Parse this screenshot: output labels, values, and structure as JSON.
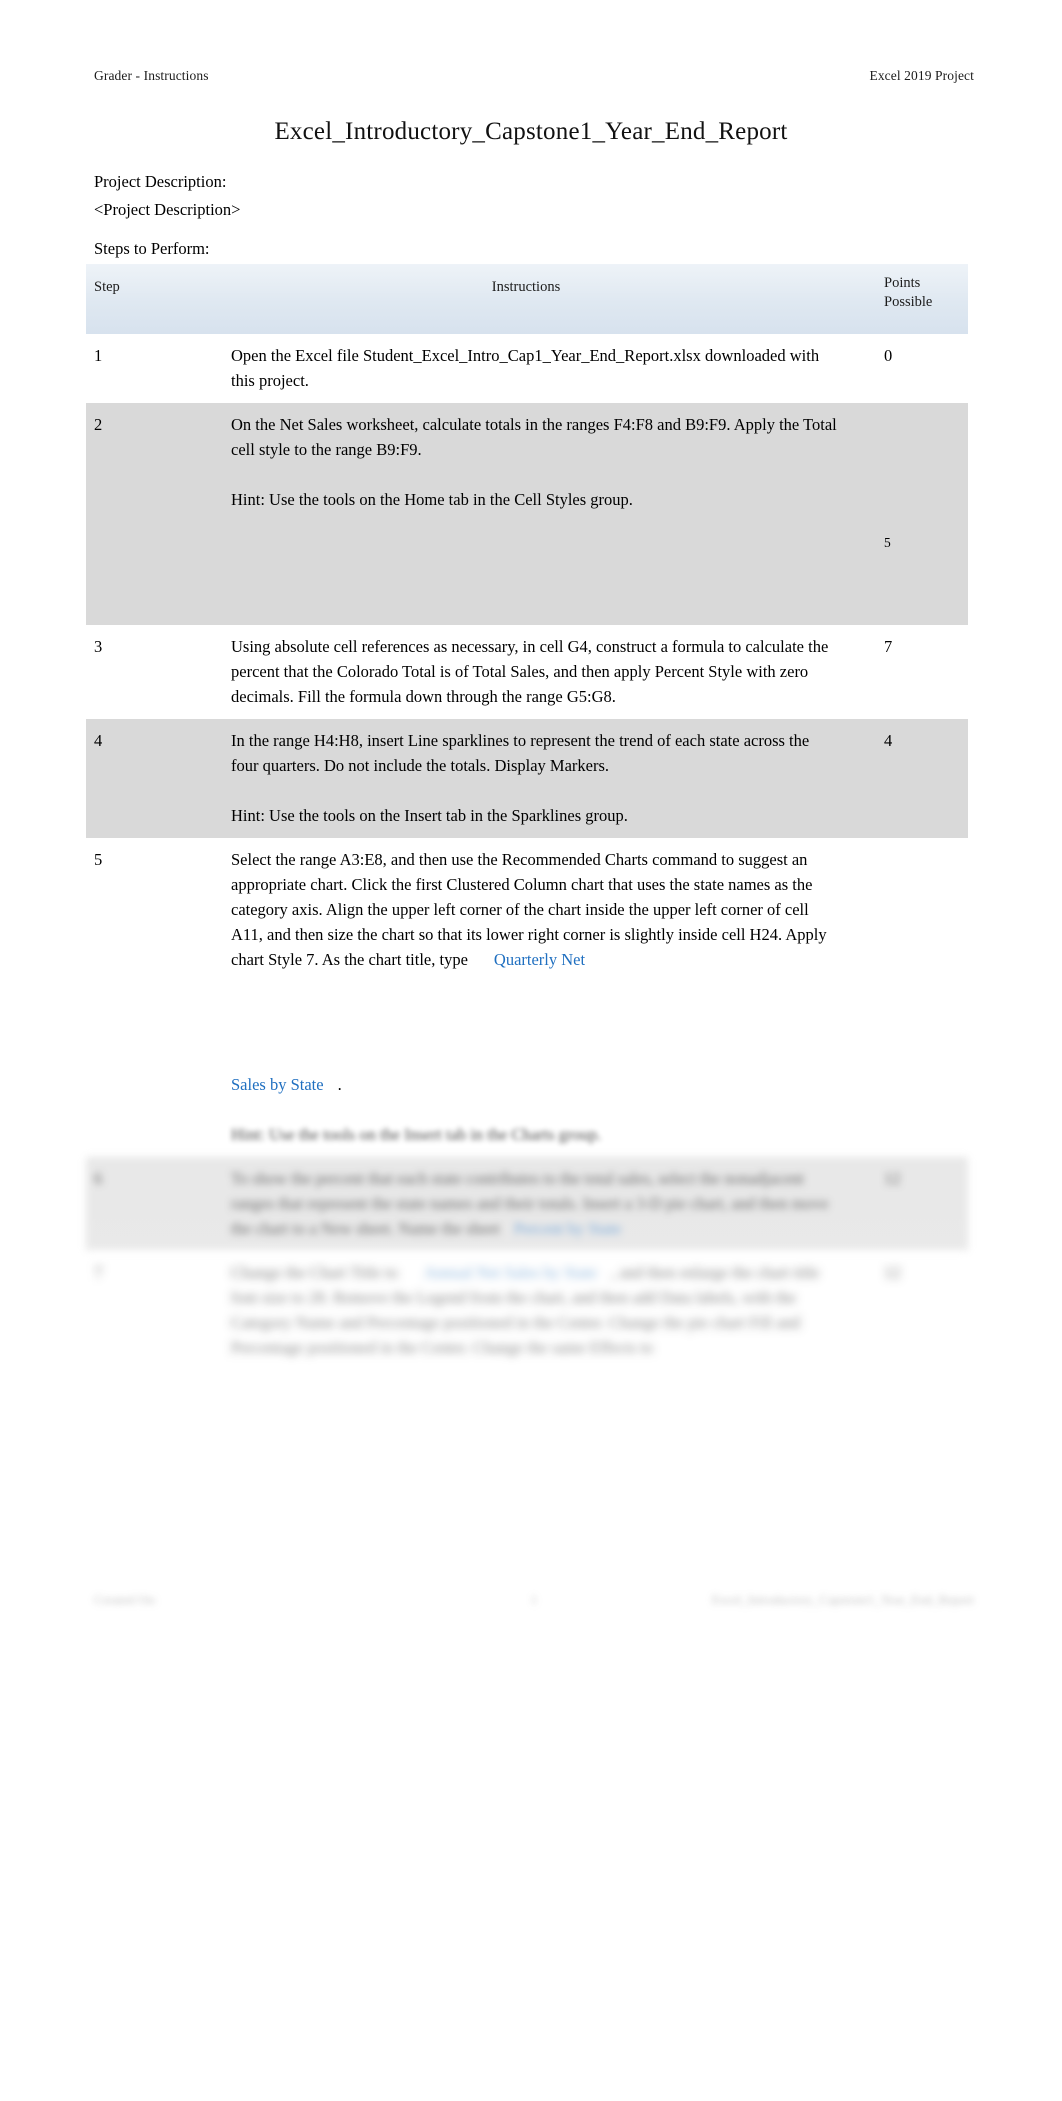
{
  "header": {
    "left": "Grader - Instructions",
    "right": "Excel 2019 Project"
  },
  "title": "Excel_Introductory_Capstone1_Year_End_Report",
  "intro": {
    "description_label": "Project Description:",
    "description_value": "<Project Description>",
    "steps_label": "Steps to Perform:"
  },
  "table": {
    "columns": {
      "step": "Step",
      "instructions": "Instructions",
      "points_line1": "Points",
      "points_line2": "Possible"
    },
    "rows": [
      {
        "step": "1",
        "paragraphs": [
          "Open the Excel file    Student_Excel_Intro_Cap1_Year_End_Report.xlsx downloaded with this project."
        ],
        "points": "0",
        "shaded": false
      },
      {
        "step": "2",
        "paragraphs": [
          "On the Net Sales worksheet, calculate totals in the ranges F4:F8 and B9:F9. Apply the Total cell style to the range B9:F9.",
          "Hint: Use the tools on the Home tab in the Cell Styles group."
        ],
        "points": "5",
        "shaded": true
      },
      {
        "step": "3",
        "paragraphs": [
          "Using absolute cell references as necessary, in cell G4, construct a formula to calculate the percent that the Colorado Total is of Total Sales, and then apply Percent Style with zero decimals. Fill the formula down through the range G5:G8."
        ],
        "points": "7",
        "shaded": false
      },
      {
        "step": "4",
        "paragraphs": [
          "In the range H4:H8, insert Line sparklines to represent the trend of each state across the four quarters. Do not include the totals. Display Markers.",
          "Hint: Use the tools on the Insert tab in the Sparklines group."
        ],
        "points": "4",
        "shaded": true
      },
      {
        "step": "5",
        "lead": "Select the range A3:E8, and then use the Recommended Charts command to suggest an appropriate chart. Click the first Clustered Column chart that uses the state names as the category axis. Align the upper left corner of the chart inside the upper left corner of cell A11, and then size the chart so that its lower right corner is slightly inside cell H24. Apply chart Style 7. As the chart title, type",
        "blue1": "Quarterly Net",
        "blue2": "Sales by State",
        "tail": ".",
        "hint": "Hint: Use the tools on the Insert tab in the Charts group.",
        "points": "",
        "shaded": false
      },
      {
        "step": "6",
        "paragraphs": [
          "To show the percent that each state contributes to the total sales, select the nonadjacent ranges that represent the state names and their totals. Insert a 3-D pie chart, and then move the chart to a New sheet. Name the sheet",
          ""
        ],
        "blue": "Percent by State",
        "points": "12",
        "shaded": true
      },
      {
        "step": "7",
        "lead": "Change the Chart Title to",
        "blue": "Annual Net Sales by State",
        "tail": ", and then enlarge the chart title font size to 28. Remove the Legend from the chart, and then add Data labels, with the Category Name and Percentage positioned in the Center. Change the pie chart Fill and Percentage positioned in the Center. Change the same Effects to",
        "points": "12",
        "shaded": false
      }
    ]
  },
  "footer": {
    "left": "Created On:",
    "center": "1",
    "right": "Excel_Introductory_Capstone1_Year_End_Report"
  }
}
